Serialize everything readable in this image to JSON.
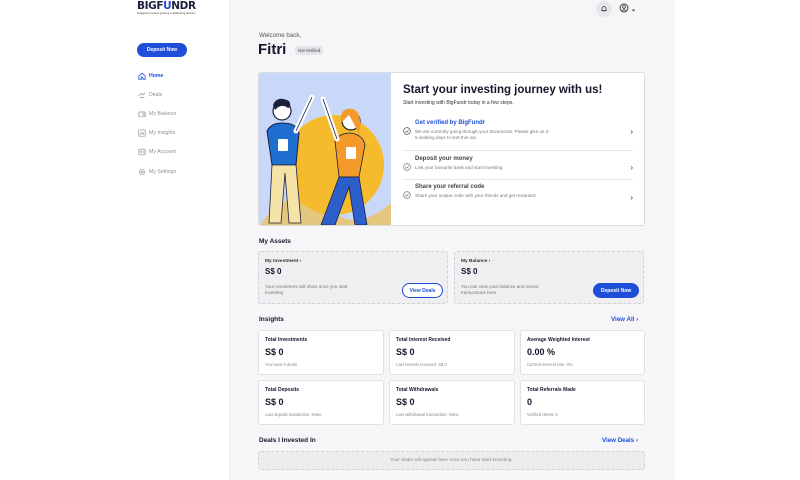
{
  "brand": {
    "logo_main": "BIGF",
    "logo_accent": "U",
    "logo_end": "NDR",
    "logo_tagline": "Singapore's fastest-growing crowdfunding platform",
    "accent_color": "#1f4fd8"
  },
  "sidebar": {
    "deposit_label": "Deposit Now",
    "items": [
      {
        "label": "Home",
        "icon": "home-icon",
        "active": true
      },
      {
        "label": "Deals",
        "icon": "deals-icon",
        "active": false
      },
      {
        "label": "My Balance",
        "icon": "wallet-icon",
        "active": false
      },
      {
        "label": "My Insights",
        "icon": "insights-icon",
        "active": false
      },
      {
        "label": "My Account",
        "icon": "account-icon",
        "active": false
      },
      {
        "label": "My Settings",
        "icon": "gear-icon",
        "active": false
      }
    ]
  },
  "header": {
    "welcome": "Welcome back,",
    "username": "Fitri",
    "status_badge": "Not Verified"
  },
  "hero": {
    "title": "Start your investing journey with us!",
    "subtitle": "Start investing with BigFundr today in a few steps.",
    "steps": [
      {
        "title": "Get verified by BigFundr",
        "desc": "We are currently going through your documents. Please give us 3-5 working days to sort this out.",
        "highlight": true
      },
      {
        "title": "Deposit your money",
        "desc": "Link your favourite bank and start investing",
        "highlight": false
      },
      {
        "title": "Share your referral code",
        "desc": "Share your unique code with your friends and get rewarded",
        "highlight": false
      }
    ]
  },
  "assets": {
    "title": "My Assets",
    "investment": {
      "label": "My Investment",
      "value": "S$ 0",
      "desc": "Your investment will show once you start investing",
      "button": "View Deals"
    },
    "balance": {
      "label": "My Balance",
      "value": "S$ 0",
      "desc": "You can view your balance and recent transactions here.",
      "button": "Deposit Now"
    }
  },
  "insights": {
    "title": "Insights",
    "view_all": "View All",
    "cards": [
      {
        "label": "Total Investments",
        "value": "S$ 0",
        "desc": "You have 0 deals"
      },
      {
        "label": "Total Interest Received",
        "value": "S$ 0",
        "desc": "Last interest received: S$ 0"
      },
      {
        "label": "Average Weighted Interest",
        "value": "0.00 %",
        "desc": "Current interest rate: 0%"
      },
      {
        "label": "Total Deposits",
        "value": "S$ 0",
        "desc": "Last deposit transaction: None"
      },
      {
        "label": "Total Withdrawals",
        "value": "S$ 0",
        "desc": "Last withdrawal transaction: None"
      },
      {
        "label": "Total Referrals Made",
        "value": "0",
        "desc": "Verified Users: 0"
      }
    ]
  },
  "deals": {
    "title": "Deals I Invested In",
    "view_link": "View Deals",
    "empty": "Your deals will appear here once you have start investing."
  }
}
